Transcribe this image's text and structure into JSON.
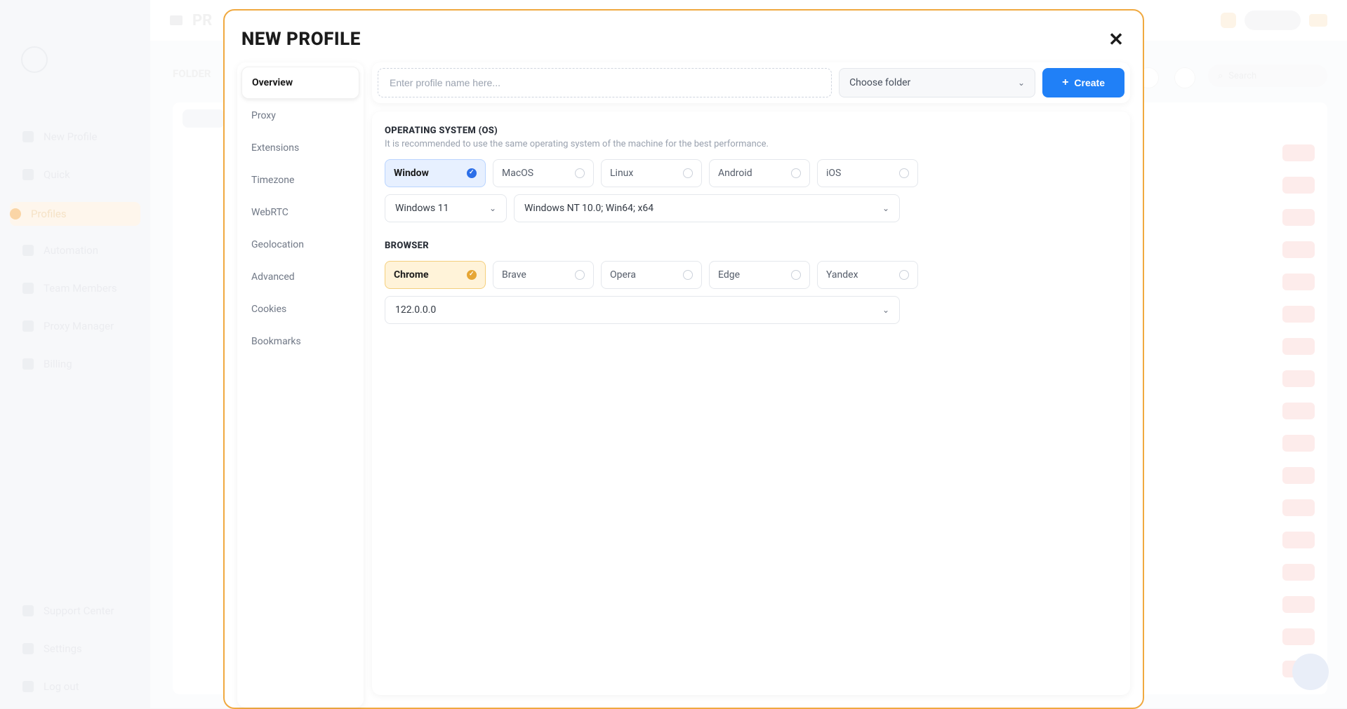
{
  "background": {
    "header_title": "PR",
    "top_label": "FOLDER",
    "search_placeholder": "Search",
    "nav": {
      "new_profile": "New Profile",
      "quick": "Quick",
      "profiles": "Profiles",
      "automation": "Automation",
      "team_members": "Team Members",
      "proxy_manager": "Proxy Manager",
      "billing": "Billing",
      "support_center": "Support Center",
      "settings": "Settings",
      "log_out": "Log out"
    }
  },
  "modal": {
    "title": "NEW PROFILE",
    "tabs": [
      "Overview",
      "Proxy",
      "Extensions",
      "Timezone",
      "WebRTC",
      "Geolocation",
      "Advanced",
      "Cookies",
      "Bookmarks"
    ],
    "active_tab": "Overview",
    "topbar": {
      "name_placeholder": "Enter profile name here...",
      "folder_label": "Choose folder",
      "create_label": "Create"
    },
    "os_section": {
      "title": "OPERATING SYSTEM (OS)",
      "subtitle": "It is recommended to use the same operating system of the machine for the best performance.",
      "options": [
        "Window",
        "MacOS",
        "Linux",
        "Android",
        "iOS"
      ],
      "selected": "Window",
      "version": "Windows 11",
      "ua": "Windows NT 10.0; Win64; x64"
    },
    "browser_section": {
      "title": "BROWSER",
      "options": [
        "Chrome",
        "Brave",
        "Opera",
        "Edge",
        "Yandex"
      ],
      "selected": "Chrome",
      "version": "122.0.0.0"
    }
  }
}
